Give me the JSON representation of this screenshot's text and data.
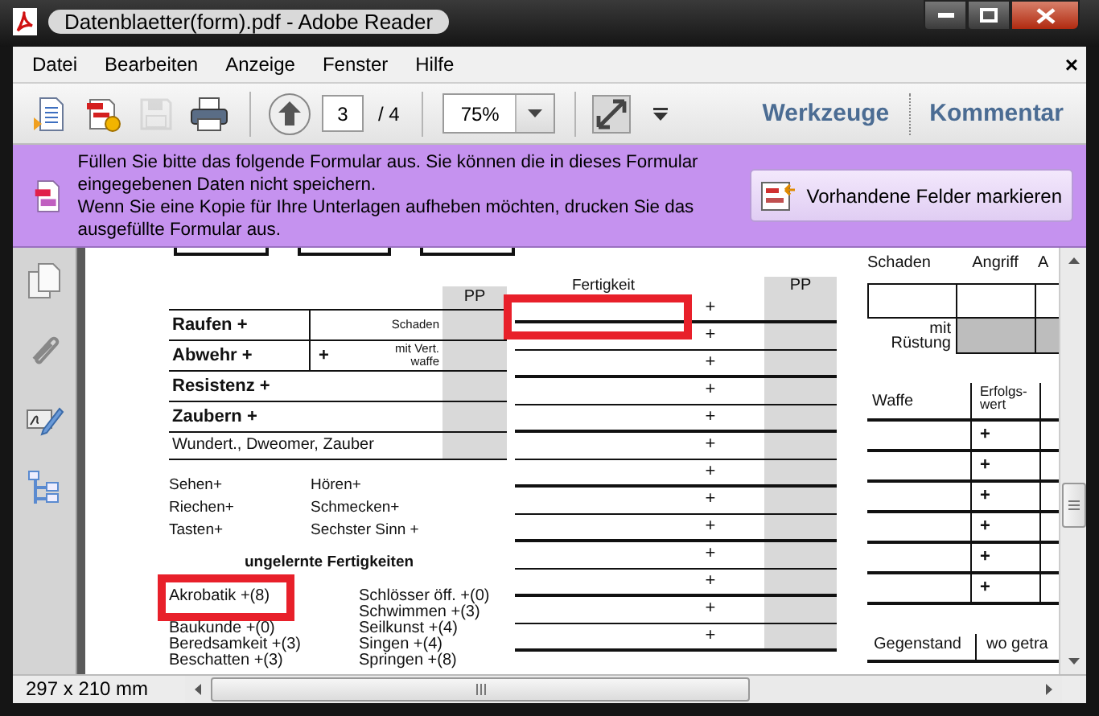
{
  "window": {
    "title": "Datenblaetter(form).pdf - Adobe Reader"
  },
  "menu": {
    "items": [
      "Datei",
      "Bearbeiten",
      "Anzeige",
      "Fenster",
      "Hilfe"
    ],
    "close": "×"
  },
  "toolbar": {
    "buttons": [
      {
        "kind": "export",
        "disabled": false
      },
      {
        "kind": "form",
        "disabled": false
      },
      {
        "kind": "save",
        "disabled": true
      },
      {
        "kind": "print",
        "disabled": false
      }
    ],
    "page": "3",
    "page_total": "/ 4",
    "zoom": "75%",
    "panels": [
      "Werkzeuge",
      "Kommentar"
    ]
  },
  "form_bar": {
    "messages": [
      "Füllen Sie bitte das folgende Formular aus. Sie können die in dieses Formular eingegebenen Daten nicht speichern.",
      "Wenn Sie eine Kopie für Ihre Unterlagen aufheben möchten, drucken Sie das ausgefüllte Formular aus."
    ],
    "button": "Vorhandene Felder markieren"
  },
  "document": {
    "skills": {
      "pp_header": "PP",
      "rows": [
        {
          "kind": "split",
          "label": "Raufen +",
          "note": [
            "Schaden"
          ]
        },
        {
          "kind": "split",
          "label": "Abwehr +",
          "plus": "+",
          "note": [
            "mit Vert.",
            "waffe"
          ]
        },
        {
          "kind": "full",
          "label": "Resistenz +"
        },
        {
          "kind": "full",
          "label": "Zaubern +"
        },
        {
          "kind": "small",
          "label": "Wundert., Dweomer, Zauber"
        }
      ]
    },
    "senses": [
      "Sehen+",
      "Hören+",
      "Riechen+",
      "Schmecken+",
      "Tasten+",
      "Sechster Sinn +"
    ],
    "untrained": {
      "title": "ungelernte Fertigkeiten",
      "columns": [
        [
          {
            "text": "Akrobatik +(8)",
            "highlighted": true
          },
          {
            "text": "Baukunde +(0)",
            "highlighted": false
          },
          {
            "text": "Beredsamkeit +(3)",
            "highlighted": false
          },
          {
            "text": "Beschatten +(3)",
            "highlighted": false
          }
        ],
        [
          {
            "text": "Schlösser öff. +(0)",
            "highlighted": false
          },
          {
            "text": "Schwimmen +(3)",
            "highlighted": false
          },
          {
            "text": "Seilkunst +(4)",
            "highlighted": false
          },
          {
            "text": "Singen +(4)",
            "highlighted": false
          },
          {
            "text": "Springen +(8)",
            "highlighted": false
          }
        ]
      ]
    },
    "fertigkeit": {
      "header": "Fertigkeit",
      "pp_header": "PP",
      "rows": [
        {
          "plus": "+",
          "highlighted": true
        },
        {
          "plus": "+",
          "highlighted": false
        },
        {
          "plus": "+",
          "highlighted": false
        },
        {
          "plus": "+",
          "highlighted": false
        },
        {
          "plus": "+",
          "highlighted": false
        },
        {
          "plus": "+",
          "highlighted": false
        },
        {
          "plus": "+",
          "highlighted": false
        },
        {
          "plus": "+",
          "highlighted": false
        },
        {
          "plus": "+",
          "highlighted": false
        },
        {
          "plus": "+",
          "highlighted": false
        },
        {
          "plus": "+",
          "highlighted": false
        },
        {
          "plus": "+",
          "highlighted": false
        },
        {
          "plus": "+",
          "highlighted": false
        }
      ]
    },
    "bonus": {
      "headers": [
        "Schaden",
        "Angriff",
        "A"
      ],
      "armor_label": "mit Rüstung"
    },
    "weapons": {
      "headers": [
        "Waffe",
        "Erfolgs-wert"
      ],
      "rows": [
        {
          "plus": "+"
        },
        {
          "plus": "+"
        },
        {
          "plus": "+"
        },
        {
          "plus": "+"
        },
        {
          "plus": "+"
        },
        {
          "plus": "+"
        }
      ]
    },
    "items": {
      "headers": [
        "Gegenstand",
        "wo getra"
      ]
    }
  },
  "status_bar": {
    "page_size": "297 x 210 mm"
  }
}
